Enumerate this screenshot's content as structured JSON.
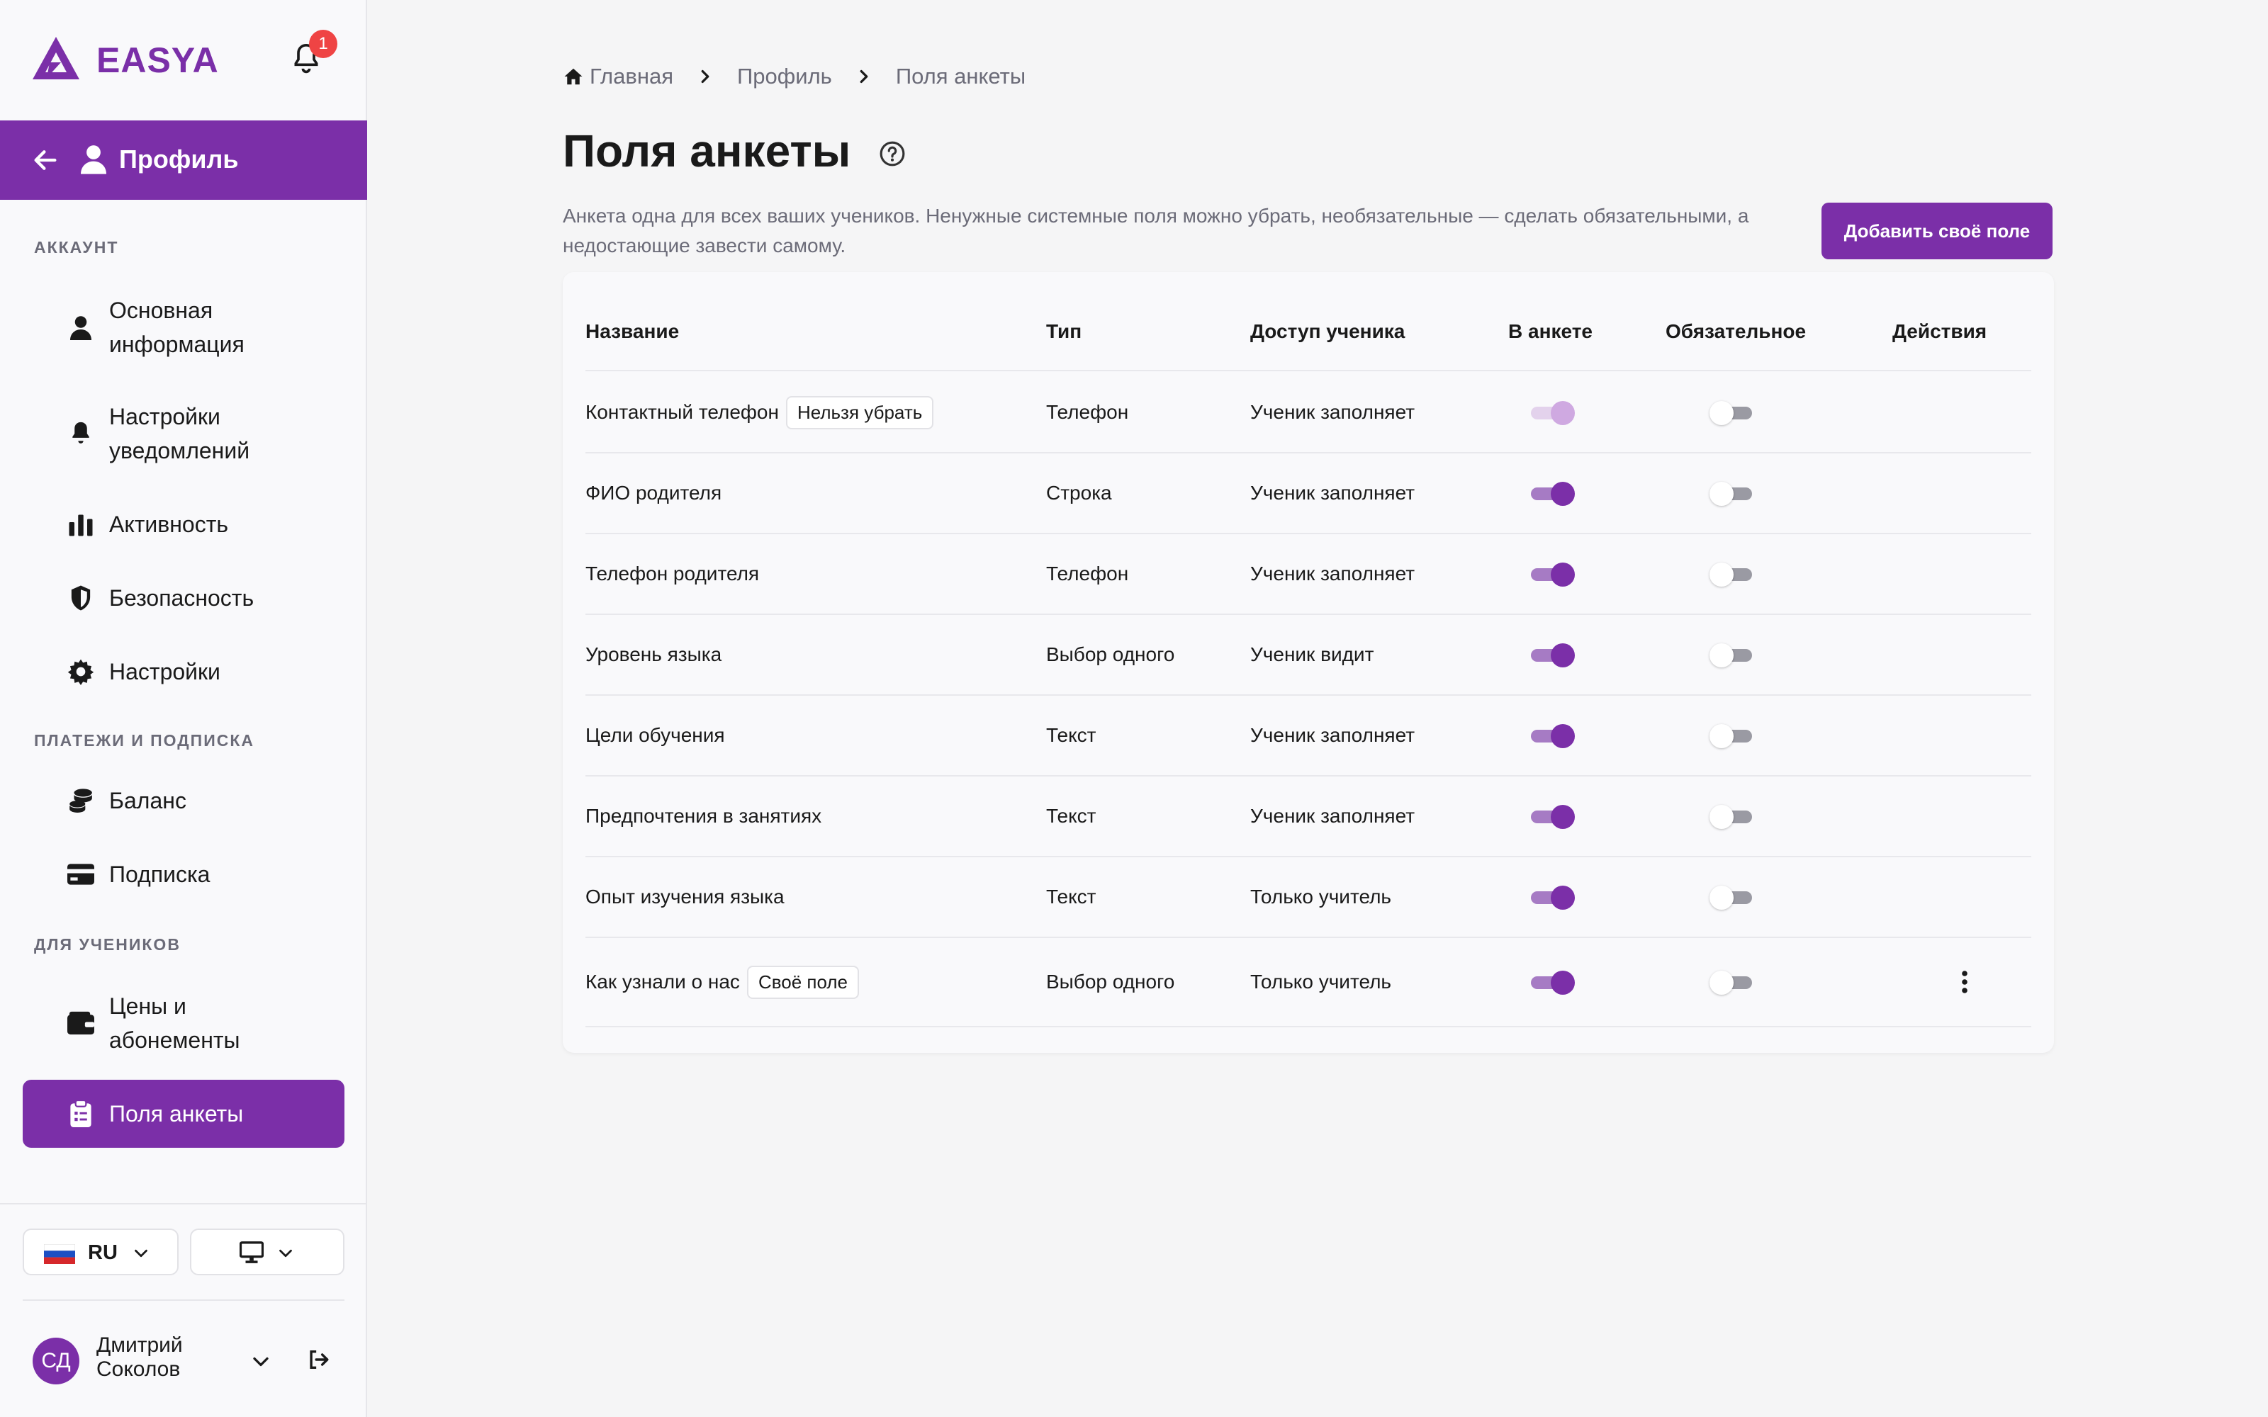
{
  "app": {
    "logo_text": "EASYA",
    "notification_count": "1"
  },
  "sidebar": {
    "profile_label": "Профиль",
    "sections": {
      "account": "АККАУНТ",
      "payments": "ПЛАТЕЖИ И ПОДПИСКА",
      "students": "ДЛЯ УЧЕНИКОВ"
    },
    "items": {
      "basic_info": "Основная информация",
      "notifications": "Настройки уведомлений",
      "activity": "Активность",
      "security": "Безопасность",
      "settings": "Настройки",
      "balance": "Баланс",
      "subscription": "Подписка",
      "prices": "Цены и абонементы",
      "form_fields": "Поля анкеты"
    },
    "language": "RU",
    "user": {
      "initials": "СД",
      "name": "Дмитрий Соколов"
    }
  },
  "breadcrumb": [
    "Главная",
    "Профиль",
    "Поля анкеты"
  ],
  "page": {
    "title": "Поля анкеты",
    "description": "Анкета одна для всех ваших учеников. Ненужные системные поля можно убрать, необязательные — сделать обязательными, а недостающие завести самому.",
    "add_button": "Добавить своё поле"
  },
  "table": {
    "headers": {
      "name": "Название",
      "type": "Тип",
      "access": "Доступ ученика",
      "in_form": "В анкете",
      "required": "Обязательное",
      "actions": "Действия"
    },
    "rows": [
      {
        "name": "Контактный телефон",
        "tag": "Нельзя убрать",
        "type": "Телефон",
        "access": "Ученик заполняет",
        "in_form": "on-disabled",
        "required": "off",
        "has_actions": false
      },
      {
        "name": "ФИО родителя",
        "tag": "",
        "type": "Строка",
        "access": "Ученик заполняет",
        "in_form": "on",
        "required": "off",
        "has_actions": false
      },
      {
        "name": "Телефон родителя",
        "tag": "",
        "type": "Телефон",
        "access": "Ученик заполняет",
        "in_form": "on",
        "required": "off",
        "has_actions": false
      },
      {
        "name": "Уровень языка",
        "tag": "",
        "type": "Выбор одного",
        "access": "Ученик видит",
        "in_form": "on",
        "required": "off",
        "has_actions": false
      },
      {
        "name": "Цели обучения",
        "tag": "",
        "type": "Текст",
        "access": "Ученик заполняет",
        "in_form": "on",
        "required": "off",
        "has_actions": false
      },
      {
        "name": "Предпочтения в занятиях",
        "tag": "",
        "type": "Текст",
        "access": "Ученик заполняет",
        "in_form": "on",
        "required": "off",
        "has_actions": false
      },
      {
        "name": "Опыт изучения языка",
        "tag": "",
        "type": "Текст",
        "access": "Только учитель",
        "in_form": "on",
        "required": "off",
        "has_actions": false
      },
      {
        "name": "Как узнали о нас",
        "tag": "Своё поле",
        "type": "Выбор одного",
        "access": "Только учитель",
        "in_form": "on",
        "required": "off",
        "has_actions": true
      }
    ]
  },
  "colors": {
    "accent": "#7b2fa8",
    "badge": "#ef4444"
  }
}
